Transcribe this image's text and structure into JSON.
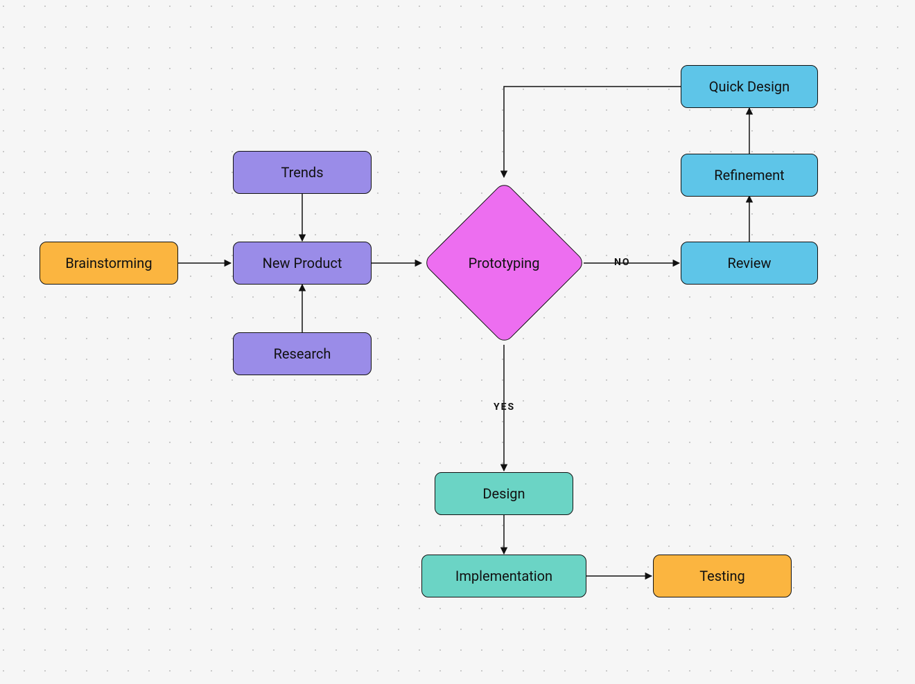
{
  "nodes": {
    "brainstorming": "Brainstorming",
    "trends": "Trends",
    "new_product": "New Product",
    "research": "Research",
    "prototyping": "Prototyping",
    "quick_design": "Quick Design",
    "refinement": "Refinement",
    "review": "Review",
    "design": "Design",
    "implementation": "Implementation",
    "testing": "Testing"
  },
  "edge_labels": {
    "no": "NO",
    "yes": "YES"
  },
  "colors": {
    "orange": "#fbb540",
    "violet": "#9a8ce8",
    "magenta": "#ed6ef0",
    "cyan": "#5ec5e8",
    "teal": "#6bd4c5",
    "stroke": "#111111",
    "bg": "#f6f6f6",
    "dot": "#c9c9c9"
  },
  "chart_data": {
    "type": "flowchart",
    "nodes": [
      {
        "id": "brainstorming",
        "label": "Brainstorming",
        "shape": "rect",
        "color": "orange"
      },
      {
        "id": "trends",
        "label": "Trends",
        "shape": "rect",
        "color": "violet"
      },
      {
        "id": "new_product",
        "label": "New Product",
        "shape": "rect",
        "color": "violet"
      },
      {
        "id": "research",
        "label": "Research",
        "shape": "rect",
        "color": "violet"
      },
      {
        "id": "prototyping",
        "label": "Prototyping",
        "shape": "diamond",
        "color": "magenta"
      },
      {
        "id": "quick_design",
        "label": "Quick Design",
        "shape": "rect",
        "color": "cyan"
      },
      {
        "id": "refinement",
        "label": "Refinement",
        "shape": "rect",
        "color": "cyan"
      },
      {
        "id": "review",
        "label": "Review",
        "shape": "rect",
        "color": "cyan"
      },
      {
        "id": "design",
        "label": "Design",
        "shape": "rect",
        "color": "teal"
      },
      {
        "id": "implementation",
        "label": "Implementation",
        "shape": "rect",
        "color": "teal"
      },
      {
        "id": "testing",
        "label": "Testing",
        "shape": "rect",
        "color": "orange"
      }
    ],
    "edges": [
      {
        "from": "brainstorming",
        "to": "new_product"
      },
      {
        "from": "trends",
        "to": "new_product"
      },
      {
        "from": "research",
        "to": "new_product"
      },
      {
        "from": "new_product",
        "to": "prototyping"
      },
      {
        "from": "prototyping",
        "to": "review",
        "label": "NO"
      },
      {
        "from": "review",
        "to": "refinement"
      },
      {
        "from": "refinement",
        "to": "quick_design"
      },
      {
        "from": "quick_design",
        "to": "prototyping"
      },
      {
        "from": "prototyping",
        "to": "design",
        "label": "YES"
      },
      {
        "from": "design",
        "to": "implementation"
      },
      {
        "from": "implementation",
        "to": "testing"
      }
    ]
  }
}
